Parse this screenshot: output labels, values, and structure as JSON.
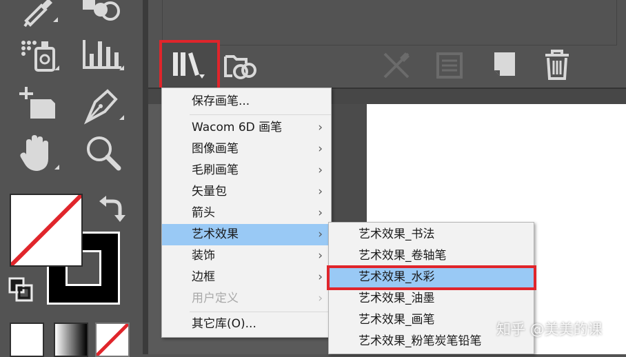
{
  "toolbar": {
    "tools": [
      {
        "name": "eyedropper-tool"
      },
      {
        "name": "shape-builder-tool"
      },
      {
        "name": "symbol-sprayer-tool"
      },
      {
        "name": "column-graph-tool"
      },
      {
        "name": "artboard-tool"
      },
      {
        "name": "pen-tool"
      },
      {
        "name": "hand-tool"
      },
      {
        "name": "zoom-tool"
      }
    ],
    "colors": {
      "fill": "#ffffff",
      "none_slash": "#e0252b",
      "stroke": "#000000"
    }
  },
  "panel": {
    "highlight_color": "#e0252b"
  },
  "menu": {
    "items": [
      {
        "label": "保存画笔...",
        "arrow": "",
        "state": "normal"
      },
      {
        "label": "Wacom 6D 画笔",
        "arrow": "›",
        "state": "normal"
      },
      {
        "label": "图像画笔",
        "arrow": "›",
        "state": "normal"
      },
      {
        "label": "毛刷画笔",
        "arrow": "›",
        "state": "normal"
      },
      {
        "label": "矢量包",
        "arrow": "›",
        "state": "normal"
      },
      {
        "label": "箭头",
        "arrow": "›",
        "state": "normal"
      },
      {
        "label": "艺术效果",
        "arrow": "›",
        "state": "selected"
      },
      {
        "label": "装饰",
        "arrow": "›",
        "state": "normal"
      },
      {
        "label": "边框",
        "arrow": "›",
        "state": "normal"
      },
      {
        "label": "用户定义",
        "arrow": "›",
        "state": "disabled"
      },
      {
        "label": "其它库(O)...",
        "arrow": "",
        "state": "normal"
      }
    ],
    "selected_bg": "#99c9f5"
  },
  "submenu": {
    "items": [
      {
        "label": "艺术效果_书法"
      },
      {
        "label": "艺术效果_卷轴笔"
      },
      {
        "label": "艺术效果_水彩"
      },
      {
        "label": "艺术效果_油墨"
      },
      {
        "label": "艺术效果_画笔"
      },
      {
        "label": "艺术效果_粉笔炭笔铅笔"
      }
    ]
  },
  "watermark": {
    "text": "知乎 @美美的课"
  }
}
